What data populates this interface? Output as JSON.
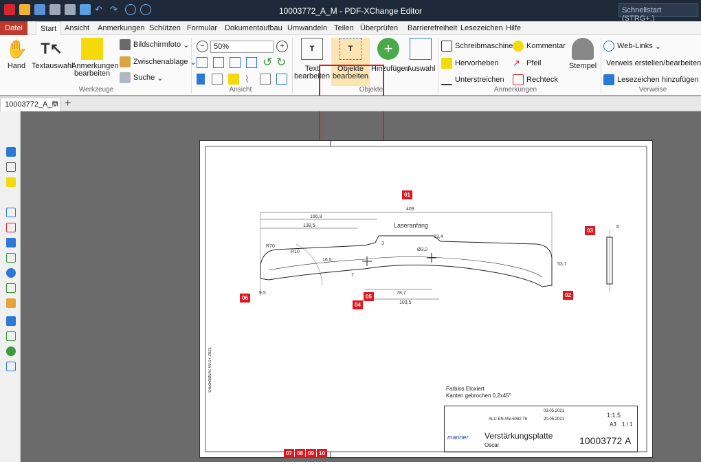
{
  "window": {
    "title": "10003772_A_M - PDF-XChange Editor",
    "search_placeholder": "Schnellstart (STRG+.)"
  },
  "menu": [
    "Datei",
    "Start",
    "Ansicht",
    "Anmerkungen",
    "Schützen",
    "Formular",
    "Dokumentaufbau",
    "Umwandeln",
    "Teilen",
    "Überprüfen",
    "Barrierefreiheit",
    "Lesezeichen",
    "Hilfe"
  ],
  "ribbon": {
    "werkzeuge": {
      "label": "Werkzeuge",
      "hand": "Hand",
      "textauswahl": "Textauswahl",
      "anmerkungen": "Anmerkungen bearbeiten",
      "bildschirmfoto": "Bildschirmfoto",
      "zwischenablage": "Zwischenablage",
      "suche": "Suche"
    },
    "ansicht": {
      "label": "Ansicht",
      "zoom": "50%"
    },
    "objekte": {
      "label": "Objekte",
      "text": "Text bearbeiten",
      "objekte": "Objekte bearbeiten",
      "hinzufuegen": "Hinzufügen",
      "auswahl": "Auswahl"
    },
    "anmerkungen": {
      "label": "Anmerkungen",
      "schreibmaschine": "Schreibmaschine",
      "hervorheben": "Hervorheben",
      "unterstreichen": "Unterstreichen",
      "kommentar": "Kommentar",
      "pfeil": "Pfeil",
      "rechteck": "Rechteck",
      "stempel": "Stempel"
    },
    "verweise": {
      "label": "Verweise",
      "weblinks": "Web-Links",
      "verweis": "Verweis erstellen/bearbeiten",
      "lesezeichen": "Lesezeichen hinzufügen"
    }
  },
  "doc_tab": "10003772_A_M",
  "drawing": {
    "dims": [
      "409",
      "166,9",
      "138,5",
      "78,7",
      "103,5",
      "53,7",
      "16,5",
      "6",
      "9,5",
      "Ø3,2",
      "3",
      "7",
      "R70",
      "R10",
      "13,4"
    ],
    "note_laser": "Laseranfang",
    "tags": [
      "01",
      "02",
      "03",
      "04",
      "05",
      "06",
      "07",
      "08",
      "09",
      "10"
    ],
    "notes": [
      "Farblos Eloxiert",
      "Kanten gebrochen 0,2x45°"
    ],
    "title_part": "Verstärkungsplatte",
    "designer": "Oscar",
    "part_no": "10003772",
    "rev": "A",
    "scale": "1:1.5",
    "format": "A3",
    "sheet": "1 / 1",
    "material": "ALU EN AW-6082 T6",
    "date1": "03.05.2021",
    "date2": "20.05.2021",
    "company": "mariner",
    "print_date": "Druckdatum: 09.07.2021"
  }
}
